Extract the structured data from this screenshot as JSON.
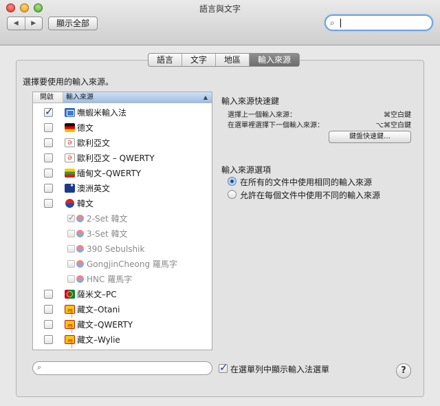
{
  "window": {
    "title": "語言與文字"
  },
  "toolbar": {
    "back": "◀",
    "forward": "▶",
    "show_all": "顯示全部",
    "search_icon": "magnifier-icon",
    "search_value": ""
  },
  "tabs": [
    {
      "label": "語言",
      "active": false
    },
    {
      "label": "文字",
      "active": false
    },
    {
      "label": "地區",
      "active": false
    },
    {
      "label": "輸入來源",
      "active": true
    }
  ],
  "left": {
    "title": "選擇要使用的輸入來源。",
    "columns": {
      "enable": "開啟",
      "source": "輸入來源",
      "sort_icon": "▲"
    },
    "items": [
      {
        "label": "嘸蝦米輸入法",
        "checked": true,
        "icon": "ime-icon"
      },
      {
        "label": "德文",
        "checked": false,
        "icon": "flag-germany-icon"
      },
      {
        "label": "歐利亞文",
        "checked": false,
        "icon": "ipa-icon"
      },
      {
        "label": "歐利亞文 – QWERTY",
        "checked": false,
        "icon": "ipa-icon"
      },
      {
        "label": "緬甸文–QWERTY",
        "checked": false,
        "icon": "flag-myanmar-icon"
      },
      {
        "label": "澳洲英文",
        "checked": false,
        "icon": "flag-australia-icon"
      },
      {
        "label": "韓文",
        "checked": false,
        "icon": "flag-korea-icon"
      },
      {
        "label": "2-Set 韓文",
        "checked": true,
        "icon": "korean-sub-icon",
        "sub": true
      },
      {
        "label": "3-Set 韓文",
        "checked": false,
        "icon": "korean-sub-icon",
        "sub": true
      },
      {
        "label": "390 Sebulshik",
        "checked": false,
        "icon": "korean-sub-icon",
        "sub": true
      },
      {
        "label": "GongjinCheong 羅馬字",
        "checked": false,
        "icon": "korean-sub-icon",
        "sub": true
      },
      {
        "label": "HNC 羅馬字",
        "checked": false,
        "icon": "korean-sub-icon",
        "sub": true
      },
      {
        "label": "薩米文–PC",
        "checked": false,
        "icon": "flag-sami-icon"
      },
      {
        "label": "藏文–Otani",
        "checked": false,
        "icon": "tibetan-icon"
      },
      {
        "label": "藏文–QWERTY",
        "checked": false,
        "icon": "tibetan-icon"
      },
      {
        "label": "藏文–Wylie",
        "checked": false,
        "icon": "tibetan-icon"
      }
    ]
  },
  "shortcuts": {
    "heading": "輸入來源快速鍵",
    "prev_label": "選擇上一個輸入來源：",
    "prev_key": "⌘空白鍵",
    "next_label": "在選單裡選擇下一個輸入來源：",
    "next_key": "⌥⌘空白鍵",
    "button": "鍵盤快速鍵…"
  },
  "options": {
    "heading": "輸入來源選項",
    "same": "在所有的文件中使用相同的輸入來源",
    "different": "允許在每個文件中使用不同的輸入來源"
  },
  "bottom": {
    "search_icon": "magnifier-icon",
    "show_menu_label": "在選單列中顯示輸入法選單",
    "show_menu_checked": true,
    "help": "?"
  }
}
